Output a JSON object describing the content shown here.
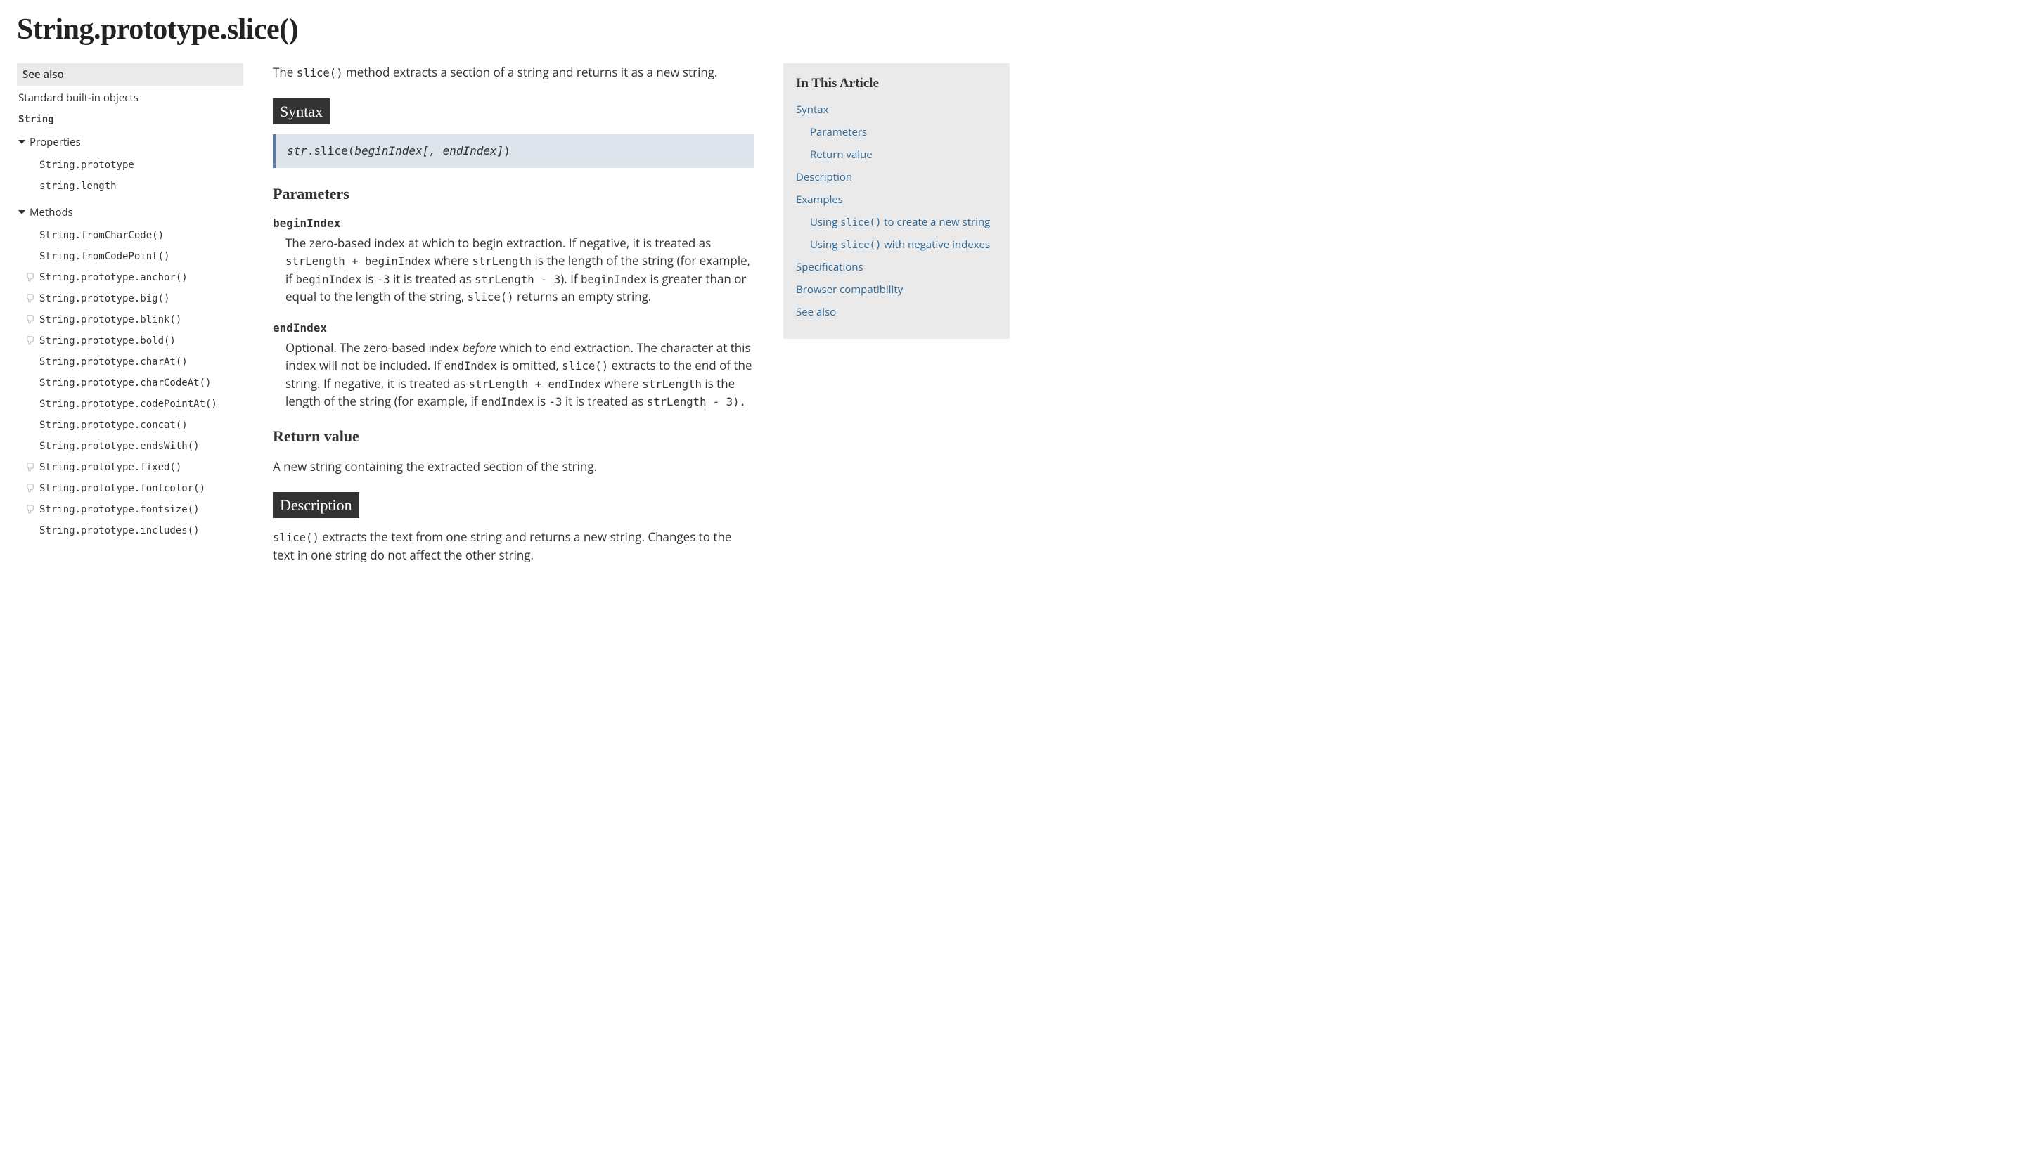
{
  "title": "String.prototype.slice()",
  "sidebar": {
    "see_also": "See also",
    "std_builtin": "Standard built-in objects",
    "obj": "String",
    "group_properties": "Properties",
    "properties": [
      {
        "label": "String.prototype",
        "deprecated": false
      },
      {
        "label": "string.length",
        "deprecated": false
      }
    ],
    "group_methods": "Methods",
    "methods": [
      {
        "label": "String.fromCharCode()",
        "deprecated": false
      },
      {
        "label": "String.fromCodePoint()",
        "deprecated": false
      },
      {
        "label": "String.prototype.anchor()",
        "deprecated": true
      },
      {
        "label": "String.prototype.big()",
        "deprecated": true
      },
      {
        "label": "String.prototype.blink()",
        "deprecated": true
      },
      {
        "label": "String.prototype.bold()",
        "deprecated": true
      },
      {
        "label": "String.prototype.charAt()",
        "deprecated": false
      },
      {
        "label": "String.prototype.charCodeAt()",
        "deprecated": false
      },
      {
        "label": "String.prototype.codePointAt()",
        "deprecated": false
      },
      {
        "label": "String.prototype.concat()",
        "deprecated": false
      },
      {
        "label": "String.prototype.endsWith()",
        "deprecated": false
      },
      {
        "label": "String.prototype.fixed()",
        "deprecated": true
      },
      {
        "label": "String.prototype.fontcolor()",
        "deprecated": true
      },
      {
        "label": "String.prototype.fontsize()",
        "deprecated": true
      },
      {
        "label": "String.prototype.includes()",
        "deprecated": false
      }
    ]
  },
  "intro": {
    "pre": "The ",
    "code": "slice()",
    "post": " method extracts a section of a string and returns it as a new string."
  },
  "syntax_heading": "Syntax",
  "syntax_parts": {
    "obj": "str",
    "dot_method": ".slice(",
    "arg1": "beginIndex",
    "optional": "[, endIndex]",
    "close": ")"
  },
  "parameters_heading": "Parameters",
  "params": {
    "begin_name": "beginIndex",
    "begin_desc_1": "The zero-based index at which to begin extraction. If negative, it is treated as ",
    "begin_code1": "strLength + beginIndex",
    "begin_desc_2": " where ",
    "begin_code2": "strLength",
    "begin_desc_3": " is the length of the string (for example, if ",
    "begin_code3": "beginIndex",
    "begin_desc_4": " is ",
    "begin_code4": "-3",
    "begin_desc_5": " it is treated as ",
    "begin_code5": "strLength - 3",
    "begin_desc_6": "). If ",
    "begin_code6": "beginIndex",
    "begin_desc_7": " is greater than or equal to the length of the string, ",
    "begin_code7": "slice()",
    "begin_desc_8": " returns an empty string.",
    "end_name": "endIndex",
    "end_desc_1": "Optional. The zero-based index ",
    "end_italic": "before",
    "end_desc_2": " which to end extraction. The character at this index will not be included. If ",
    "end_code1": "endIndex",
    "end_desc_3": " is omitted, ",
    "end_code2": "slice()",
    "end_desc_4": " extracts to the end of the string. If negative, it is treated as ",
    "end_code3": "strLength + endIndex",
    "end_desc_5": " where ",
    "end_code4": "strLength",
    "end_desc_6": " is the length of the string (for example, if ",
    "end_code5": "endIndex",
    "end_desc_7": " is ",
    "end_code6": "-3",
    "end_desc_8": " it is treated as ",
    "end_code7": "strLength - 3).",
    "end_desc_9": ""
  },
  "return_heading": "Return value",
  "return_text": "A new string containing the extracted section of the string.",
  "description_heading": "Description",
  "description": {
    "code": "slice()",
    "text": " extracts the text from one string and returns a new string. Changes to the text in one string do not affect the other string."
  },
  "toc": {
    "heading": "In This Article",
    "items": [
      {
        "label": "Syntax",
        "sub": false,
        "code": null
      },
      {
        "label": "Parameters",
        "sub": true,
        "code": null
      },
      {
        "label": "Return value",
        "sub": true,
        "code": null
      },
      {
        "label": "Description",
        "sub": false,
        "code": null
      },
      {
        "label": "Examples",
        "sub": false,
        "code": null
      },
      {
        "label_pre": "Using ",
        "code": "slice()",
        "label_post": " to create a new string",
        "sub": true
      },
      {
        "label_pre": "Using ",
        "code": "slice()",
        "label_post": " with negative indexes",
        "sub": true
      },
      {
        "label": "Specifications",
        "sub": false,
        "code": null
      },
      {
        "label": "Browser compatibility",
        "sub": false,
        "code": null
      },
      {
        "label": "See also",
        "sub": false,
        "code": null
      }
    ]
  }
}
